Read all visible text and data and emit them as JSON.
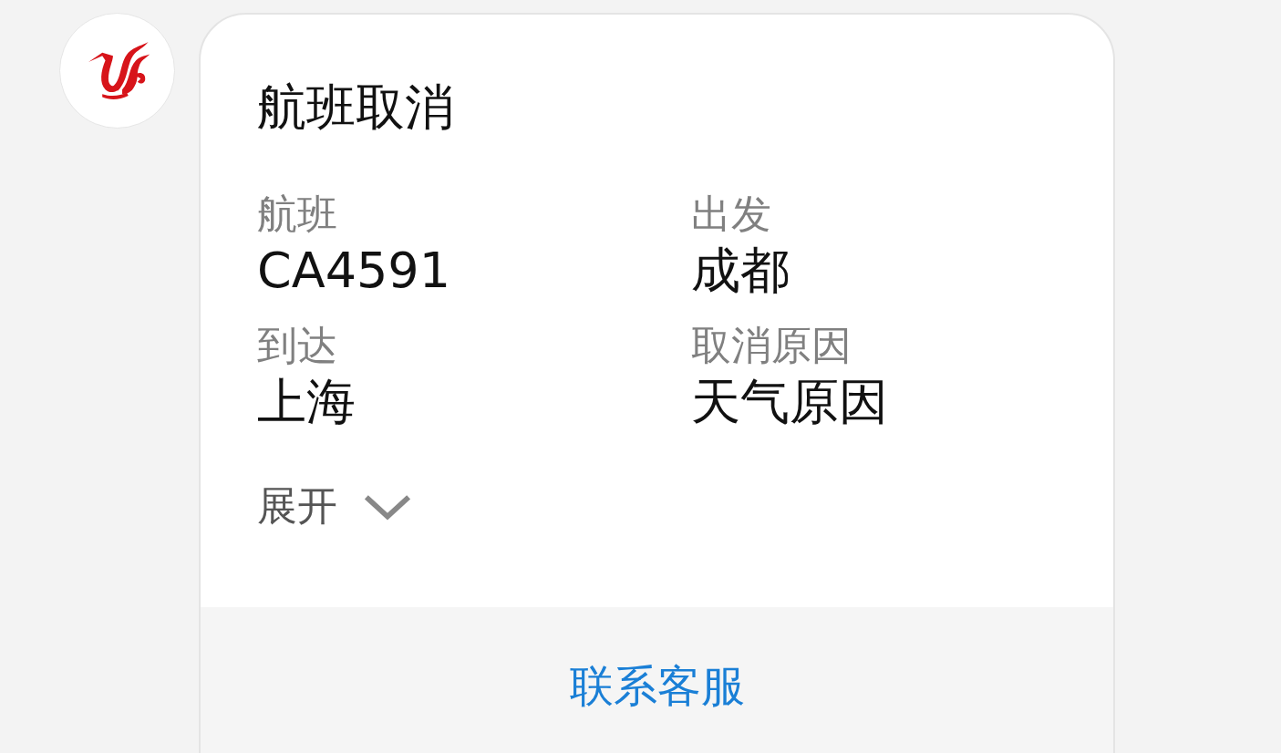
{
  "card": {
    "title": "航班取消",
    "fields": [
      {
        "label": "航班",
        "value": "CA4591"
      },
      {
        "label": "出发",
        "value": "成都"
      },
      {
        "label": "到达",
        "value": "上海"
      },
      {
        "label": "取消原因",
        "value": "天气原因"
      }
    ],
    "expand": {
      "label": "展开",
      "expanded": false
    },
    "action": "联系客服"
  }
}
